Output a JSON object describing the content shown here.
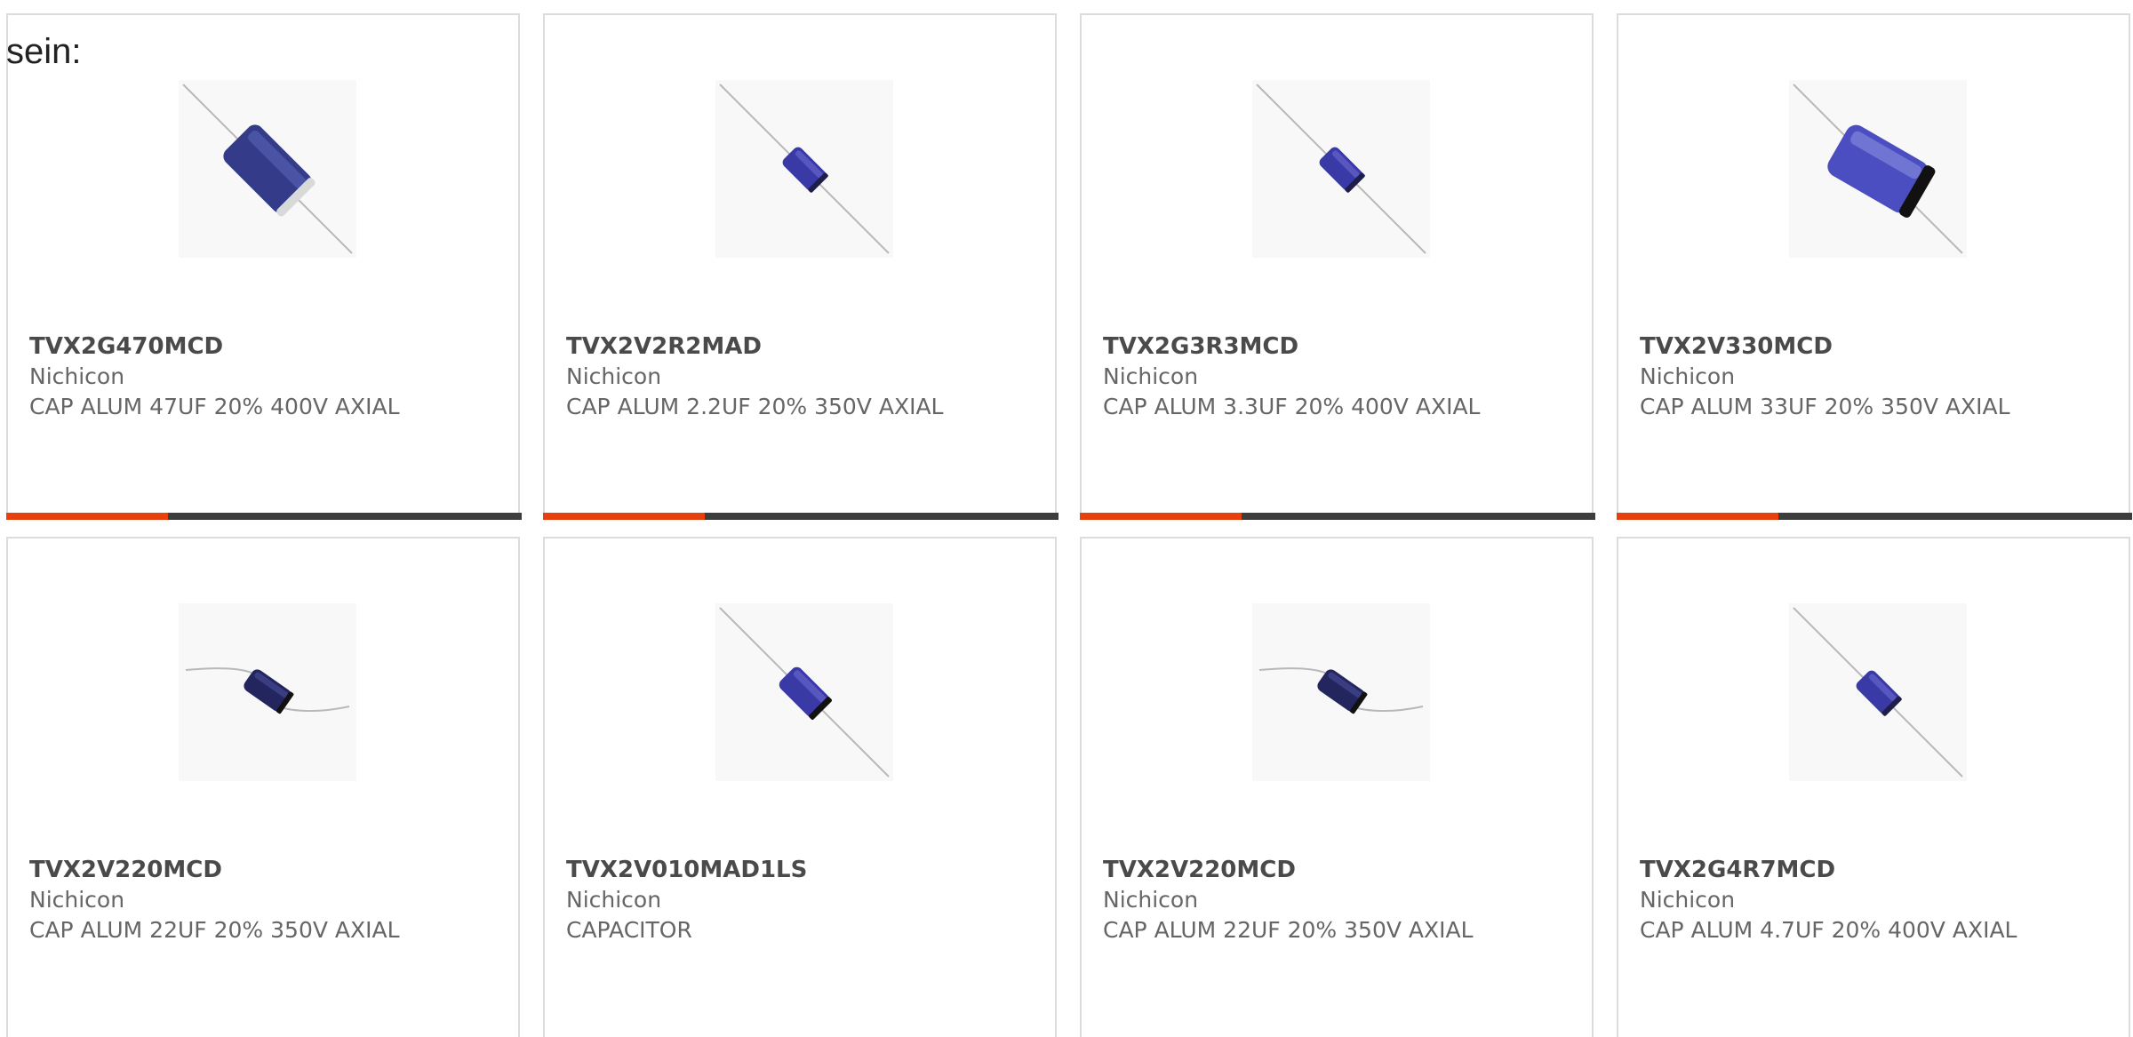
{
  "intro_text": "sein:",
  "colors": {
    "accent": "#e8400c",
    "bar": "#3d3d3d",
    "capacitor_body": "#3a3aa6"
  },
  "products": [
    {
      "part_number": "TVX2G470MCD",
      "manufacturer": "Nichicon",
      "description": "CAP ALUM 47UF 20% 400V AXIAL",
      "image_icon": "axial-capacitor-large-icon"
    },
    {
      "part_number": "TVX2V2R2MAD",
      "manufacturer": "Nichicon",
      "description": "CAP ALUM 2.2UF 20% 350V AXIAL",
      "image_icon": "axial-capacitor-small-icon"
    },
    {
      "part_number": "TVX2G3R3MCD",
      "manufacturer": "Nichicon",
      "description": "CAP ALUM 3.3UF 20% 400V AXIAL",
      "image_icon": "axial-capacitor-small-icon"
    },
    {
      "part_number": "TVX2V330MCD",
      "manufacturer": "Nichicon",
      "description": "CAP ALUM 33UF 20% 350V AXIAL",
      "image_icon": "axial-capacitor-large-icon"
    },
    {
      "part_number": "TVX2V220MCD",
      "manufacturer": "Nichicon",
      "description": "CAP ALUM 22UF 20% 350V AXIAL",
      "image_icon": "axial-capacitor-bent-leads-icon"
    },
    {
      "part_number": "TVX2V010MAD1LS",
      "manufacturer": "Nichicon",
      "description": "CAPACITOR",
      "image_icon": "axial-capacitor-small-icon"
    },
    {
      "part_number": "TVX2V220MCD",
      "manufacturer": "Nichicon",
      "description": "CAP ALUM 22UF 20% 350V AXIAL",
      "image_icon": "axial-capacitor-bent-leads-icon"
    },
    {
      "part_number": "TVX2G4R7MCD",
      "manufacturer": "Nichicon",
      "description": "CAP ALUM 4.7UF 20% 400V AXIAL",
      "image_icon": "axial-capacitor-small-icon"
    }
  ]
}
